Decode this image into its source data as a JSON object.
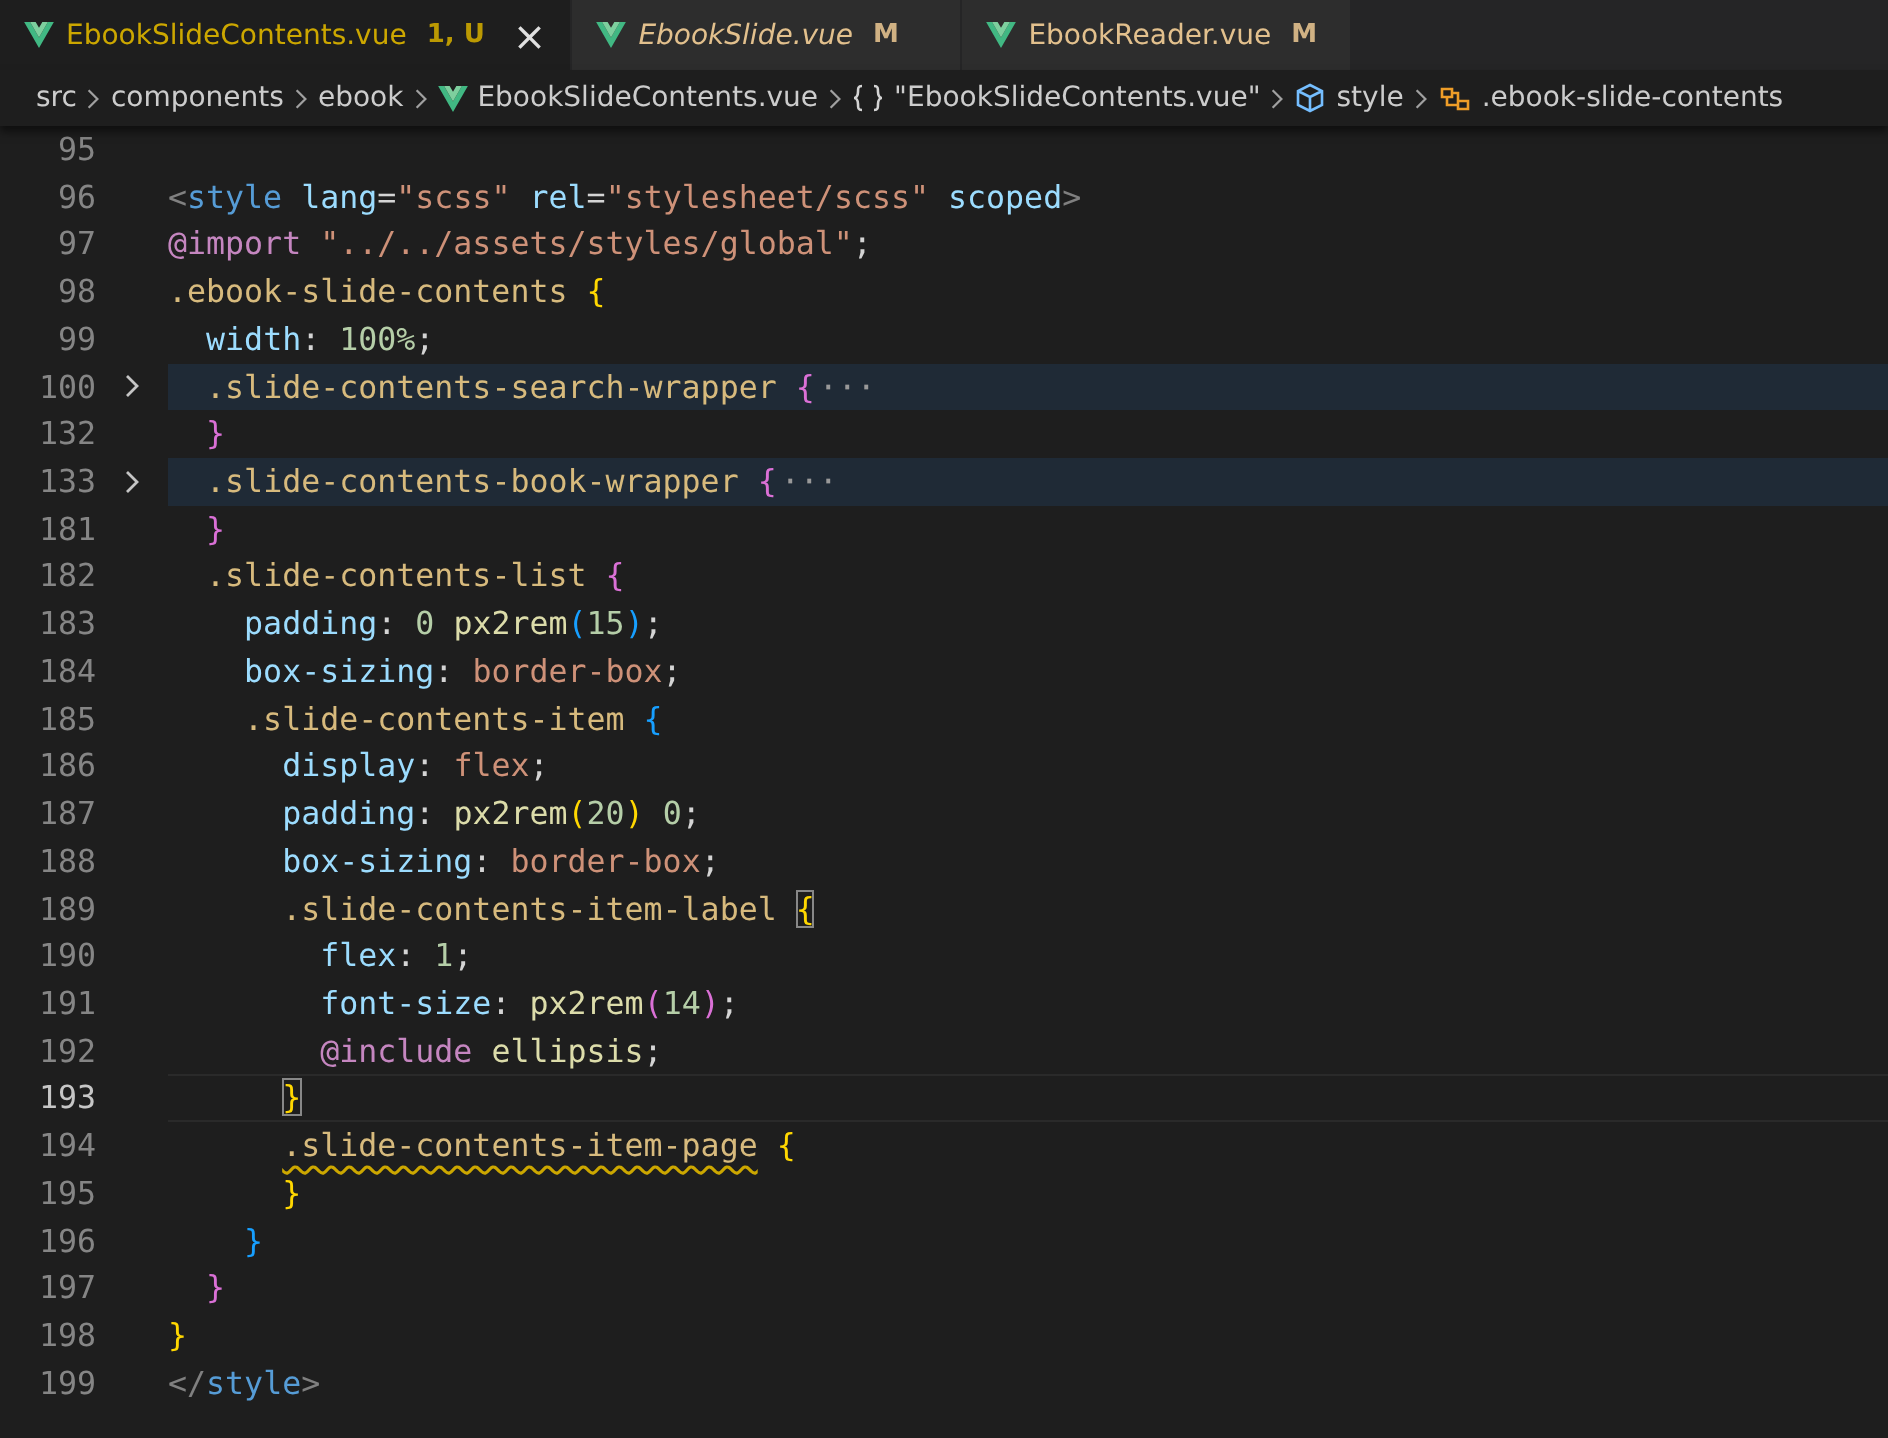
{
  "tabs": [
    {
      "label": "EbookSlideContents.vue",
      "badge": "1, U",
      "color": "#cca700",
      "selected": true,
      "preview": false,
      "close": "×"
    },
    {
      "label": "EbookSlide.vue",
      "badge": "M",
      "color": "#e2c08d",
      "selected": false,
      "preview": true
    },
    {
      "label": "EbookReader.vue",
      "badge": "M",
      "color": "#e2c08d",
      "selected": false,
      "preview": false
    }
  ],
  "breadcrumbs": [
    {
      "label": "src",
      "kind": "folder"
    },
    {
      "label": "components",
      "kind": "folder"
    },
    {
      "label": "ebook",
      "kind": "folder"
    },
    {
      "label": "EbookSlideContents.vue",
      "kind": "vue-file"
    },
    {
      "label": "\"EbookSlideContents.vue\"",
      "kind": "module"
    },
    {
      "label": "style",
      "kind": "element"
    },
    {
      "label": ".ebook-slide-contents",
      "kind": "selector"
    }
  ],
  "lines": [
    {
      "number": "95",
      "folded": false,
      "current": false
    },
    {
      "number": "96",
      "folded": false,
      "current": false,
      "tokens": [
        {
          "text": "<",
          "kind": "punct"
        },
        {
          "text": "style",
          "kind": "tag"
        },
        {
          "text": " lang",
          "kind": "attr"
        },
        {
          "text": "=",
          "kind": "plain"
        },
        {
          "text": "\"scss\"",
          "kind": "string"
        },
        {
          "text": " rel",
          "kind": "attr"
        },
        {
          "text": "=",
          "kind": "plain"
        },
        {
          "text": "\"stylesheet/scss\"",
          "kind": "string"
        },
        {
          "text": " scoped",
          "kind": "attr"
        },
        {
          "text": ">",
          "kind": "punct"
        }
      ]
    },
    {
      "number": "97",
      "folded": false,
      "current": false,
      "tokens": [
        {
          "text": "@import",
          "kind": "at-rule"
        },
        {
          "text": " \"../../assets/styles/global\"",
          "kind": "string"
        },
        {
          "text": ";",
          "kind": "plain"
        }
      ]
    },
    {
      "number": "98",
      "folded": false,
      "current": false,
      "tokens": [
        {
          "text": ".ebook-slide-contents ",
          "kind": "selector"
        },
        {
          "text": "{",
          "kind": "bracket1"
        }
      ]
    },
    {
      "number": "99",
      "folded": false,
      "current": false,
      "tokens": [
        {
          "text": "  width",
          "kind": "property"
        },
        {
          "text": ": ",
          "kind": "plain"
        },
        {
          "text": "100%",
          "kind": "number"
        },
        {
          "text": ";",
          "kind": "plain"
        }
      ]
    },
    {
      "number": "100",
      "folded": true,
      "current": false,
      "tokens": [
        {
          "text": "  .slide-contents-search-wrapper ",
          "kind": "selector"
        },
        {
          "text": "{",
          "kind": "bracket2"
        },
        {
          "text": "···",
          "kind": "ellipsis"
        }
      ]
    },
    {
      "number": "132",
      "folded": false,
      "current": false,
      "tokens": [
        {
          "text": "  }",
          "kind": "bracket2"
        }
      ]
    },
    {
      "number": "133",
      "folded": true,
      "current": false,
      "tokens": [
        {
          "text": "  .slide-contents-book-wrapper ",
          "kind": "selector"
        },
        {
          "text": "{",
          "kind": "bracket2"
        },
        {
          "text": "···",
          "kind": "ellipsis"
        }
      ]
    },
    {
      "number": "181",
      "folded": false,
      "current": false,
      "tokens": [
        {
          "text": "  }",
          "kind": "bracket2"
        }
      ]
    },
    {
      "number": "182",
      "folded": false,
      "current": false,
      "tokens": [
        {
          "text": "  .slide-contents-list ",
          "kind": "selector"
        },
        {
          "text": "{",
          "kind": "bracket2"
        }
      ]
    },
    {
      "number": "183",
      "folded": false,
      "current": false,
      "tokens": [
        {
          "text": "    padding",
          "kind": "property"
        },
        {
          "text": ": ",
          "kind": "plain"
        },
        {
          "text": "0",
          "kind": "number"
        },
        {
          "text": " px2rem",
          "kind": "function"
        },
        {
          "text": "(",
          "kind": "bracket3"
        },
        {
          "text": "15",
          "kind": "number"
        },
        {
          "text": ")",
          "kind": "bracket3"
        },
        {
          "text": ";",
          "kind": "plain"
        }
      ]
    },
    {
      "number": "184",
      "folded": false,
      "current": false,
      "tokens": [
        {
          "text": "    box-sizing",
          "kind": "property"
        },
        {
          "text": ": ",
          "kind": "plain"
        },
        {
          "text": "border-box",
          "kind": "value"
        },
        {
          "text": ";",
          "kind": "plain"
        }
      ]
    },
    {
      "number": "185",
      "folded": false,
      "current": false,
      "tokens": [
        {
          "text": "    .slide-contents-item ",
          "kind": "selector"
        },
        {
          "text": "{",
          "kind": "bracket3"
        }
      ]
    },
    {
      "number": "186",
      "folded": false,
      "current": false,
      "tokens": [
        {
          "text": "      display",
          "kind": "property"
        },
        {
          "text": ": ",
          "kind": "plain"
        },
        {
          "text": "flex",
          "kind": "value"
        },
        {
          "text": ";",
          "kind": "plain"
        }
      ]
    },
    {
      "number": "187",
      "folded": false,
      "current": false,
      "tokens": [
        {
          "text": "      padding",
          "kind": "property"
        },
        {
          "text": ": ",
          "kind": "plain"
        },
        {
          "text": "px2rem",
          "kind": "function"
        },
        {
          "text": "(",
          "kind": "bracket1"
        },
        {
          "text": "20",
          "kind": "number"
        },
        {
          "text": ")",
          "kind": "bracket1"
        },
        {
          "text": " 0",
          "kind": "number"
        },
        {
          "text": ";",
          "kind": "plain"
        }
      ]
    },
    {
      "number": "188",
      "folded": false,
      "current": false,
      "tokens": [
        {
          "text": "      box-sizing",
          "kind": "property"
        },
        {
          "text": ": ",
          "kind": "plain"
        },
        {
          "text": "border-box",
          "kind": "value"
        },
        {
          "text": ";",
          "kind": "plain"
        }
      ]
    },
    {
      "number": "189",
      "folded": false,
      "current": false,
      "tokens": [
        {
          "text": "      .slide-contents-item-label ",
          "kind": "selector"
        },
        {
          "text": "{",
          "kind": "bracket1-matched"
        }
      ]
    },
    {
      "number": "190",
      "folded": false,
      "current": false,
      "tokens": [
        {
          "text": "        flex",
          "kind": "property"
        },
        {
          "text": ": ",
          "kind": "plain"
        },
        {
          "text": "1",
          "kind": "number"
        },
        {
          "text": ";",
          "kind": "plain"
        }
      ]
    },
    {
      "number": "191",
      "folded": false,
      "current": false,
      "tokens": [
        {
          "text": "        font-size",
          "kind": "property"
        },
        {
          "text": ": ",
          "kind": "plain"
        },
        {
          "text": "px2rem",
          "kind": "function"
        },
        {
          "text": "(",
          "kind": "bracket2"
        },
        {
          "text": "14",
          "kind": "number"
        },
        {
          "text": ")",
          "kind": "bracket2"
        },
        {
          "text": ";",
          "kind": "plain"
        }
      ]
    },
    {
      "number": "192",
      "folded": false,
      "current": false,
      "tokens": [
        {
          "text": "        @include",
          "kind": "at-rule"
        },
        {
          "text": " ellipsis",
          "kind": "function"
        },
        {
          "text": ";",
          "kind": "plain"
        }
      ]
    },
    {
      "number": "193",
      "folded": false,
      "current": true,
      "tokens": [
        {
          "text": "      }",
          "kind": "bracket1-matched"
        }
      ]
    },
    {
      "number": "194",
      "folded": false,
      "current": false,
      "tokens": [
        {
          "text": "      .slide-contents-item-page",
          "kind": "selector-warning"
        },
        {
          "text": " {",
          "kind": "bracket1"
        }
      ]
    },
    {
      "number": "195",
      "folded": false,
      "current": false,
      "tokens": [
        {
          "text": "      }",
          "kind": "bracket1"
        }
      ]
    },
    {
      "number": "196",
      "folded": false,
      "current": false,
      "tokens": [
        {
          "text": "    }",
          "kind": "bracket3"
        }
      ]
    },
    {
      "number": "197",
      "folded": false,
      "current": false,
      "tokens": [
        {
          "text": "  }",
          "kind": "bracket2"
        }
      ]
    },
    {
      "number": "198",
      "folded": false,
      "current": false,
      "tokens": [
        {
          "text": "}",
          "kind": "bracket1"
        }
      ]
    },
    {
      "number": "199",
      "folded": false,
      "current": false,
      "tokens": [
        {
          "text": "</",
          "kind": "punct"
        },
        {
          "text": "style",
          "kind": "tag"
        },
        {
          "text": ">",
          "kind": "punct"
        }
      ]
    }
  ]
}
